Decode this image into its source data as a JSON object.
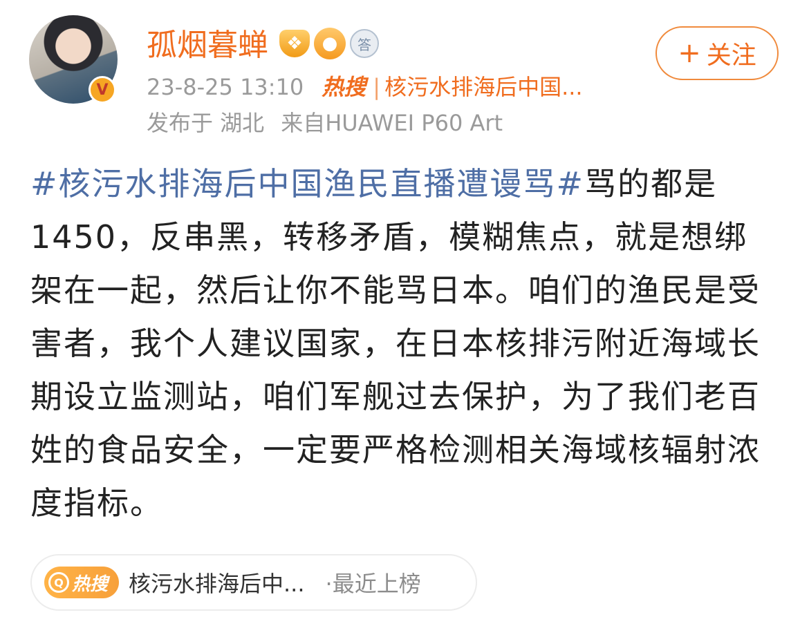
{
  "user": {
    "name": "孤烟暮蝉",
    "verified_badge": "V",
    "badge_icons": [
      "medal-icon",
      "fish-icon",
      "answer-badge-icon"
    ],
    "badge3_text": "答"
  },
  "meta": {
    "datetime": "23-8-25 13:10",
    "hot_label": "热搜",
    "hot_topic": "核污水排海后中国...",
    "location": "发布于 湖北",
    "device": "来自HUAWEI P60 Art"
  },
  "follow": {
    "plus": "+",
    "label": "关注"
  },
  "post": {
    "hashtag": "#核污水排海后中国渔民直播遭谩骂#",
    "text": "骂的都是1450，反串黑，转移矛盾，模糊焦点，就是想绑架在一起，然后让你不能骂日本。咱们的渔民是受害者，我个人建议国家，在日本核排污附近海域长期设立监测站，咱们军舰过去保护，为了我们老百姓的食品安全，一定要严格检测相关海域核辐射浓度指标。"
  },
  "topic_card": {
    "icon_q": "Q",
    "icon_label": "热搜",
    "title": "核污水排海后中...",
    "status": "·最近上榜"
  },
  "colors": {
    "accent": "#f06d1f",
    "hashtag": "#4e6ea5",
    "text": "#222222",
    "meta": "#9a9a9a"
  }
}
